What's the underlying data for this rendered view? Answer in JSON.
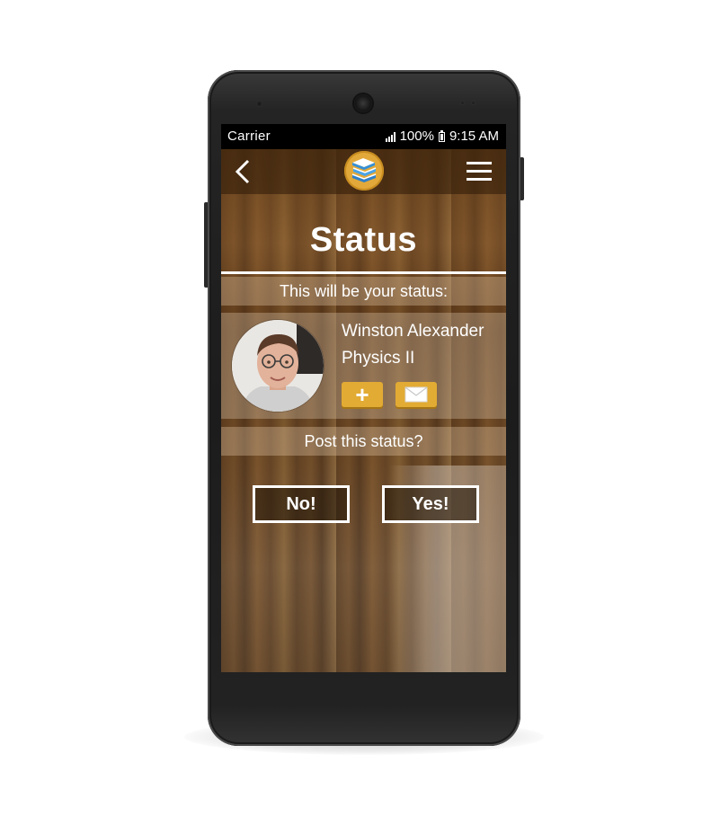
{
  "status_bar": {
    "carrier": "Carrier",
    "battery": "100%",
    "time": "9:15 AM"
  },
  "top_bar": {
    "back_icon": "chevron-left-icon",
    "logo_icon": "books-icon",
    "menu_icon": "hamburger-menu-icon"
  },
  "page": {
    "title": "Status",
    "subtitle": "This will be your status:",
    "prompt": "Post this status?"
  },
  "profile": {
    "name": "Winston Alexander",
    "course": "Physics II",
    "add_icon": "plus-icon",
    "message_icon": "envelope-icon"
  },
  "actions": {
    "no_label": "No!",
    "yes_label": "Yes!"
  },
  "colors": {
    "accent": "#e2ab33",
    "text": "#ffffff",
    "status_bar": "#000000"
  }
}
